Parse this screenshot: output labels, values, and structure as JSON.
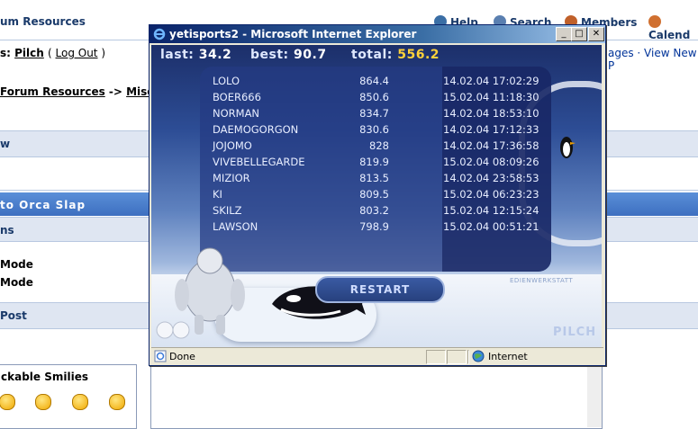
{
  "forum": {
    "header_title": "um Resources",
    "nav": [
      {
        "label": "Help",
        "icon": "help-icon",
        "color": "#3a6ea5"
      },
      {
        "label": "Search",
        "icon": "search-icon",
        "color": "#5a7fb0"
      },
      {
        "label": "Members",
        "icon": "members-icon",
        "color": "#c0602a"
      },
      {
        "label": "Calend",
        "icon": "calendar-icon",
        "color": "#d07030"
      }
    ],
    "user_prefix": "s: ",
    "username": "Pilch",
    "logout": "Log Out",
    "right_links": "ages · View New P",
    "breadcrumb_prefix": "Forum Resources",
    "breadcrumb_arrow": " -> ",
    "breadcrumb_next": "Misc",
    "row_w": "w",
    "topic_title": "to Orca Slap",
    "section_ns": "ns",
    "mode1": "Mode",
    "mode2": "Mode",
    "post_label": "Post",
    "smilies_title": "ckable Smilies"
  },
  "window": {
    "title": "yetisports2 - Microsoft Internet Explorer",
    "minimize": "_",
    "maximize": "□",
    "close": "✕",
    "status_left": "Done",
    "status_zone": "Internet"
  },
  "game": {
    "hud": {
      "last_label": "last:",
      "last_value": "34.2",
      "best_label": "best:",
      "best_value": "90.7",
      "total_label": "total:",
      "total_value": "556.2"
    },
    "highscores": [
      {
        "name": "LOLO",
        "score": "864.4",
        "date": "14.02.04 17:02:29"
      },
      {
        "name": "BOER666",
        "score": "850.6",
        "date": "15.02.04 11:18:30"
      },
      {
        "name": "NORMAN",
        "score": "834.7",
        "date": "14.02.04 18:53:10"
      },
      {
        "name": "DAEMOGORGON",
        "score": "830.6",
        "date": "14.02.04 17:12:33"
      },
      {
        "name": "JOJOMO",
        "score": "828",
        "date": "14.02.04 17:36:58"
      },
      {
        "name": "VIVEBELLEGARDE",
        "score": "819.9",
        "date": "15.02.04 08:09:26"
      },
      {
        "name": "MIZIOR",
        "score": "813.5",
        "date": "14.02.04 23:58:53"
      },
      {
        "name": "KI",
        "score": "809.5",
        "date": "15.02.04 06:23:23"
      },
      {
        "name": "SKILZ",
        "score": "803.2",
        "date": "15.02.04 12:15:24"
      },
      {
        "name": "LAWSON",
        "score": "798.9",
        "date": "15.02.04 00:51:21"
      }
    ],
    "restart_label": "RESTART",
    "watermark": "EDIENWERKSTATT",
    "player_name": "PILCH"
  }
}
